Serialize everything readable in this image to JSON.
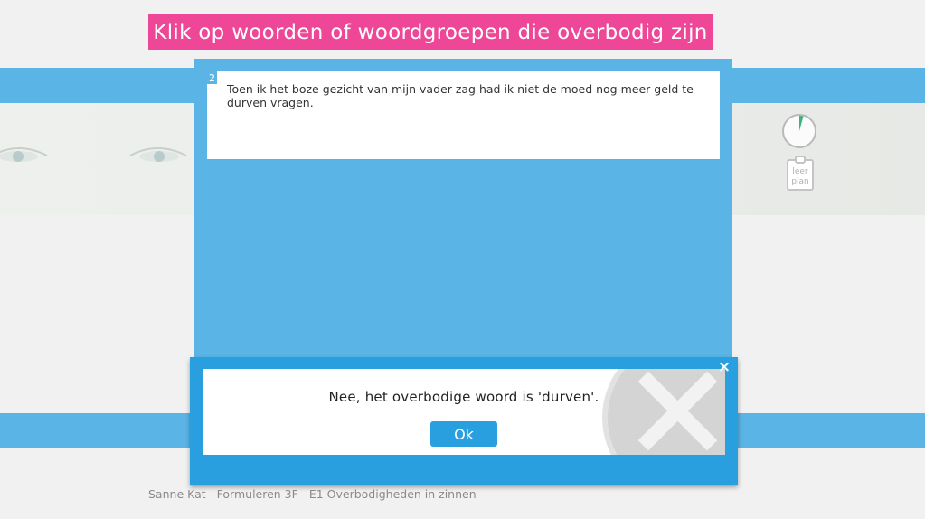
{
  "header": {
    "instruction": "Klik op woorden of woordgroepen die overbodig zijn"
  },
  "question": {
    "number": "2",
    "text": "Toen ik het boze gezicht van mijn vader zag had ik niet de moed nog meer geld te durven vragen."
  },
  "sidebar": {
    "timer_icon": "timer-icon",
    "leerplan_label_line1": "leer",
    "leerplan_label_line2": "plan"
  },
  "feedback_dialog": {
    "message": "Nee, het overbodige woord is 'durven'.",
    "ok_label": "Ok",
    "close_label": "×",
    "status_icon": "wrong-x-icon"
  },
  "footer": {
    "student": "Sanne Kat",
    "course": "Formuleren 3F",
    "exercise": "E1 Overbodigheden in zinnen"
  },
  "colors": {
    "title_banner": "#ee4798",
    "panel_blue": "#5ab5e6",
    "dialog_blue": "#2a9fdf",
    "background": "#f1f1f1"
  }
}
